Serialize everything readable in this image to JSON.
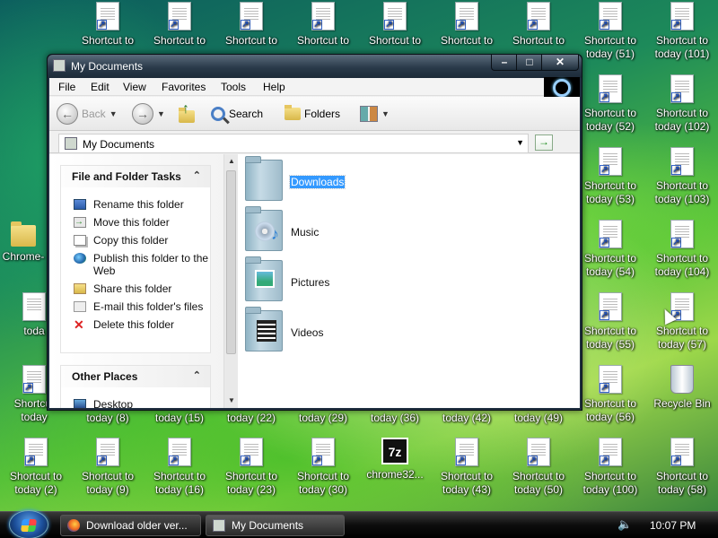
{
  "desktop": {
    "top_row": [
      {
        "l1": "Shortcut to",
        "l2": ""
      },
      {
        "l1": "Shortcut to",
        "l2": ""
      },
      {
        "l1": "Shortcut to",
        "l2": ""
      },
      {
        "l1": "Shortcut to",
        "l2": ""
      },
      {
        "l1": "Shortcut to",
        "l2": ""
      },
      {
        "l1": "Shortcut to",
        "l2": ""
      },
      {
        "l1": "Shortcut to",
        "l2": ""
      },
      {
        "l1": "Shortcut to",
        "l2": "today (51)"
      },
      {
        "l1": "Shortcut to",
        "l2": "today (101)"
      }
    ],
    "right_col_a": [
      {
        "l1": "Shortcut to",
        "l2": "today (52)"
      },
      {
        "l1": "Shortcut to",
        "l2": "today (53)"
      },
      {
        "l1": "Shortcut to",
        "l2": "today (54)"
      },
      {
        "l1": "Shortcut to",
        "l2": "today (55)"
      },
      {
        "l1": "Shortcut to",
        "l2": "today (56)"
      }
    ],
    "right_col_b": [
      {
        "l1": "Shortcut to",
        "l2": "today (102)"
      },
      {
        "l1": "Shortcut to",
        "l2": "today (103)"
      },
      {
        "l1": "Shortcut to",
        "l2": "today (104)"
      },
      {
        "l1": "Shortcut to",
        "l2": "today (57)"
      },
      {
        "l1": "Recycle Bin",
        "l2": ""
      }
    ],
    "left_col": [
      {
        "l1": "Chrome-",
        "l2": ""
      },
      {
        "l1": "toda",
        "l2": ""
      },
      {
        "l1": "Shortcut",
        "l2": "today"
      }
    ],
    "partial_row": [
      "today (8)",
      "today (15)",
      "today (22)",
      "today (29)",
      "today (36)",
      "today (42)",
      "today (49)"
    ],
    "bottom_row": [
      {
        "l1": "Shortcut to",
        "l2": "today (2)"
      },
      {
        "l1": "Shortcut to",
        "l2": "today (9)"
      },
      {
        "l1": "Shortcut to",
        "l2": "today (16)"
      },
      {
        "l1": "Shortcut to",
        "l2": "today (23)"
      },
      {
        "l1": "Shortcut to",
        "l2": "today (30)"
      },
      {
        "l1": "chrome32...",
        "l2": ""
      },
      {
        "l1": "Shortcut to",
        "l2": "today (43)"
      },
      {
        "l1": "Shortcut to",
        "l2": "today (50)"
      },
      {
        "l1": "Shortcut to",
        "l2": "today (100)"
      },
      {
        "l1": "Shortcut to",
        "l2": "today (58)"
      }
    ]
  },
  "window": {
    "title": "My Documents",
    "menu": [
      "File",
      "Edit",
      "View",
      "Favorites",
      "Tools",
      "Help"
    ],
    "toolbar": {
      "back": "Back",
      "search": "Search",
      "folders": "Folders"
    },
    "address": "My Documents",
    "tasks": {
      "file_folder": {
        "title": "File and Folder Tasks",
        "items": [
          "Rename this folder",
          "Move this folder",
          "Copy this folder",
          "Publish this folder to the Web",
          "Share this folder",
          "E-mail this folder's files",
          "Delete this folder"
        ]
      },
      "other_places": {
        "title": "Other Places",
        "items": [
          "Desktop"
        ]
      }
    },
    "folders": [
      {
        "name": "Downloads",
        "selected": true
      },
      {
        "name": "Music",
        "selected": false
      },
      {
        "name": "Pictures",
        "selected": false
      },
      {
        "name": "Videos",
        "selected": false
      }
    ]
  },
  "taskbar": {
    "buttons": [
      "Download older ver...",
      "My Documents"
    ],
    "clock": "10:07 PM"
  },
  "icons": {
    "shortcut": "shortcut-document-icon",
    "folder": "folder-icon",
    "recycle": "recycle-bin-icon",
    "sevenzip": "7z-icon",
    "speaker": "speaker-icon",
    "start": "windows-start-icon"
  }
}
